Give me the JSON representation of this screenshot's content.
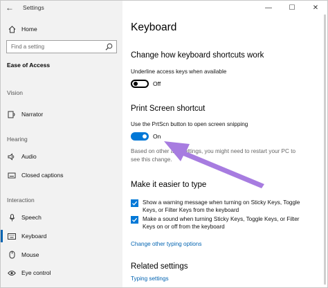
{
  "window": {
    "app_title": "Settings",
    "controls": {
      "minimize": "—",
      "maximize": "☐",
      "close": "✕"
    }
  },
  "sidebar": {
    "home_label": "Home",
    "search_placeholder": "Find a setting",
    "section_title": "Ease of Access",
    "groups": {
      "vision": "Vision",
      "hearing": "Hearing",
      "interaction": "Interaction"
    },
    "items": {
      "narrator": "Narrator",
      "audio": "Audio",
      "closed_captions": "Closed captions",
      "speech": "Speech",
      "keyboard": "Keyboard",
      "mouse": "Mouse",
      "eye_control": "Eye control"
    },
    "active_item": "Keyboard"
  },
  "main": {
    "title": "Keyboard",
    "shortcuts_heading": "Change how keyboard shortcuts work",
    "underline_label": "Underline access keys when available",
    "underline_state": "Off",
    "print_screen_heading": "Print Screen shortcut",
    "prtscn_label": "Use the PrtScn button to open screen snipping",
    "prtscn_state": "On",
    "restart_note_line1": "Based on other app settings, you might need to restart your PC to",
    "restart_note_line2": "see this change.",
    "typing_heading": "Make it easier to type",
    "checkbox_warning": "Show a warning message when turning on Sticky Keys, Toggle Keys, or Filter Keys from the keyboard",
    "checkbox_sound": "Make a sound when turning Sticky Keys, Toggle Keys, or Filter Keys on or off from the keyboard",
    "typing_options_link": "Change other typing options",
    "related_heading": "Related settings",
    "typing_settings_link": "Typing settings"
  },
  "colors": {
    "accent": "#0078d7",
    "sidebar_bg": "#f2f2f2",
    "annotation_arrow": "#a77ce0"
  }
}
